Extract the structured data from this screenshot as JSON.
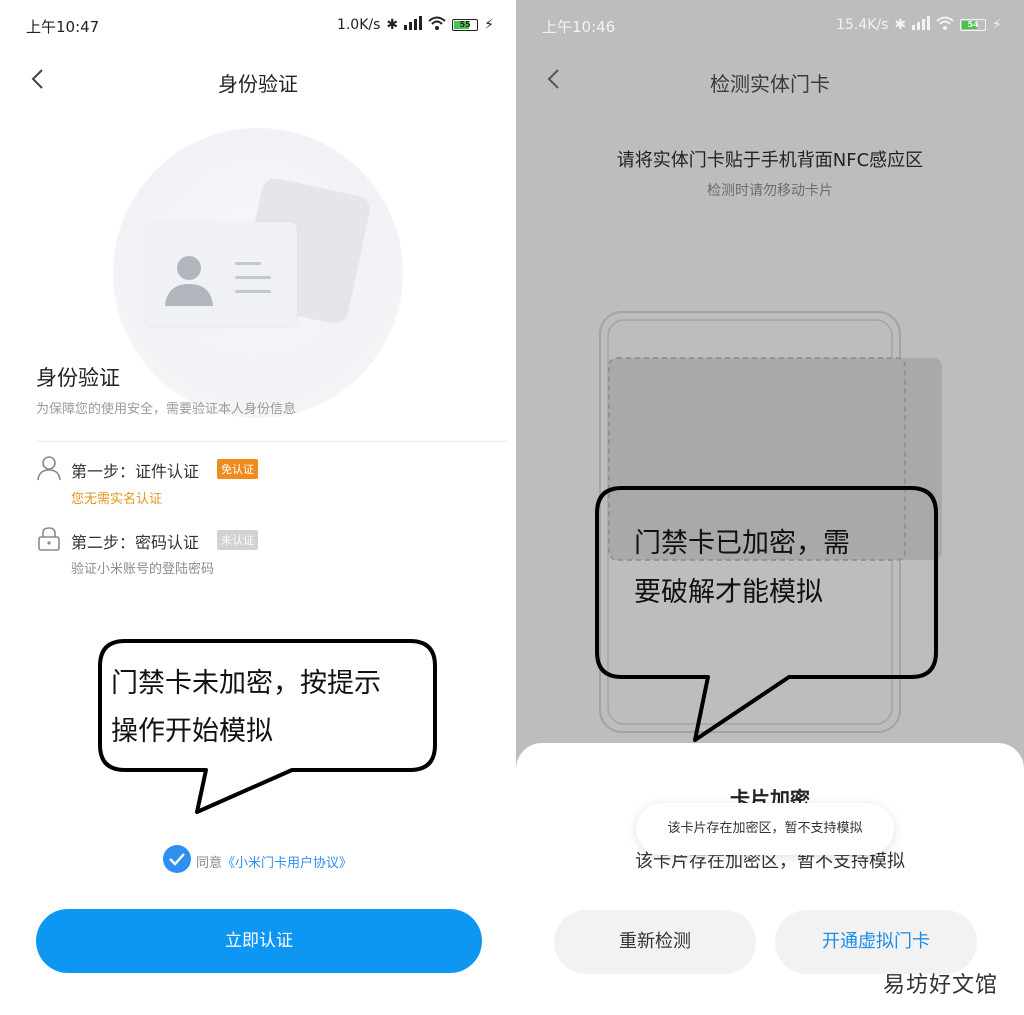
{
  "left": {
    "status": {
      "time": "上午10:47",
      "speed": "1.0K/s",
      "battery": "55"
    },
    "nav": {
      "back_icon": "chevron-left-icon",
      "title": "身份验证"
    },
    "section": {
      "title": "身份验证",
      "subtitle": "为保障您的使用安全，需要验证本人身份信息"
    },
    "steps": [
      {
        "label": "第一步：证件认证",
        "badge": "免认证",
        "badge_color": "#f08c1e",
        "sub": "您无需实名认证",
        "sub_color": "#e0961f",
        "icon": "user-icon"
      },
      {
        "label": "第二步：密码认证",
        "badge": "未认证",
        "badge_color": "#d2d2d2",
        "sub": "验证小米账号的登陆密码",
        "sub_color": "#8c8c8c",
        "icon": "lock-icon"
      }
    ],
    "callout": {
      "line1": "门禁卡未加密，按提示",
      "line2": "操作开始模拟"
    },
    "agreement": {
      "prefix": "同意",
      "link": "《小米门卡用户协议》"
    },
    "primary_button": "立即认证",
    "accent": "#0d97f3"
  },
  "right": {
    "status": {
      "time": "上午10:46",
      "speed": "15.4K/s",
      "battery": "54"
    },
    "nav": {
      "back_icon": "chevron-left-icon",
      "title": "检测实体门卡"
    },
    "instruction": "请将实体门卡贴于手机背面NFC感应区",
    "hint": "检测时请勿移动卡片",
    "callout": {
      "line1": "门禁卡已加密，需",
      "line2": "要破解才能模拟"
    },
    "sheet": {
      "title": "卡片加密",
      "message": "该卡片存在加密区，暂不支持模拟",
      "retry_button": "重新检测",
      "virtual_button": "开通虚拟门卡",
      "virtual_color": "#1a8ce8"
    },
    "toast": "该卡片存在加密区，暂不支持模拟",
    "watermark": "易坊好文馆"
  }
}
